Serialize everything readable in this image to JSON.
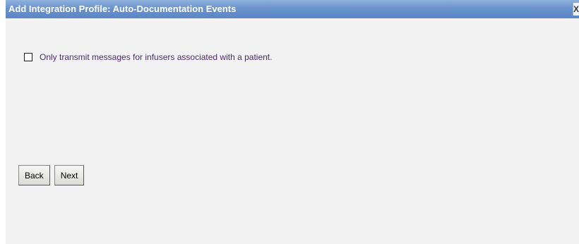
{
  "dialog": {
    "title": "Add Integration Profile: Auto-Documentation Events",
    "close_label": "X"
  },
  "option": {
    "label": "Only transmit messages for infusers associated with a patient.",
    "checked": false
  },
  "buttons": {
    "back_label": "Back",
    "next_label": "Next"
  }
}
